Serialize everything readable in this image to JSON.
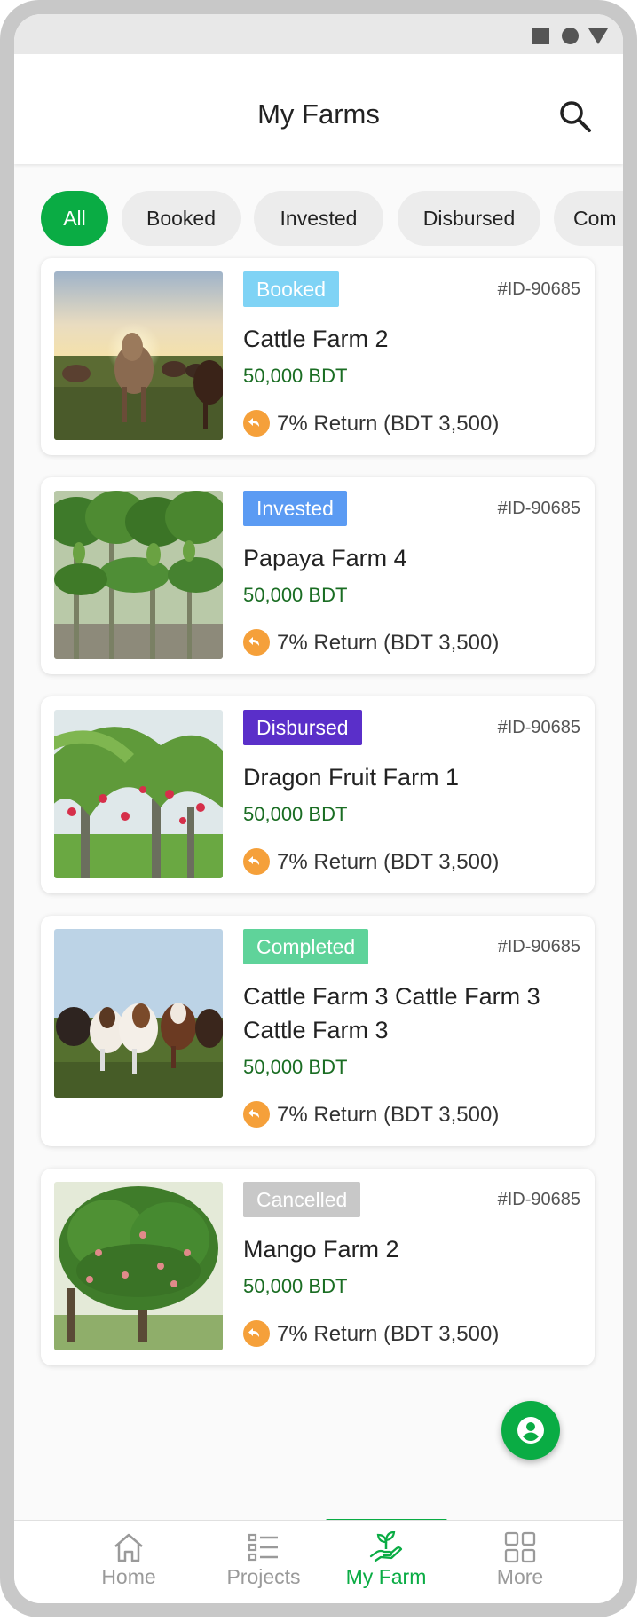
{
  "header": {
    "title": "My Farms"
  },
  "filters": [
    {
      "label": "All",
      "active": true
    },
    {
      "label": "Booked",
      "active": false
    },
    {
      "label": "Invested",
      "active": false
    },
    {
      "label": "Disbursed",
      "active": false
    },
    {
      "label": "Com",
      "active": false
    }
  ],
  "farms": [
    {
      "status": "Booked",
      "status_color": "#7fd3f5",
      "id": "#ID-90685",
      "name": "Cattle Farm 2",
      "amount": "50,000 BDT",
      "return": "7% Return (BDT 3,500)",
      "image": "cattle-herd-sunset-photo"
    },
    {
      "status": "Invested",
      "status_color": "#5b9bf3",
      "id": "#ID-90685",
      "name": "Papaya Farm 4",
      "amount": "50,000 BDT",
      "return": "7% Return (BDT 3,500)",
      "image": "papaya-trees-photo"
    },
    {
      "status": "Disbursed",
      "status_color": "#5a2fc9",
      "id": "#ID-90685",
      "name": "Dragon Fruit Farm 1",
      "amount": "50,000 BDT",
      "return": "7% Return (BDT 3,500)",
      "image": "dragon-fruit-plants-photo"
    },
    {
      "status": "Completed",
      "status_color": "#5fd39a",
      "id": "#ID-90685",
      "name": "Cattle Farm 3 Cattle Farm 3 Cattle Farm 3",
      "amount": "50,000 BDT",
      "return": "7% Return (BDT 3,500)",
      "image": "cows-in-field-photo"
    },
    {
      "status": "Cancelled",
      "status_color": "#c8c8c8",
      "id": "#ID-90685",
      "name": "Mango Farm 2",
      "amount": "50,000 BDT",
      "return": "7% Return (BDT 3,500)",
      "image": "mango-tree-photo"
    }
  ],
  "nav": [
    {
      "label": "Home",
      "icon": "home-icon",
      "active": false
    },
    {
      "label": "Projects",
      "icon": "list-icon",
      "active": false
    },
    {
      "label": "My Farm",
      "icon": "plant-in-hand-icon",
      "active": true
    },
    {
      "label": "More",
      "icon": "grid-icon",
      "active": false
    }
  ],
  "colors": {
    "primary": "#0aac44",
    "price": "#1a6d23",
    "return_icon": "#f5a03a"
  }
}
